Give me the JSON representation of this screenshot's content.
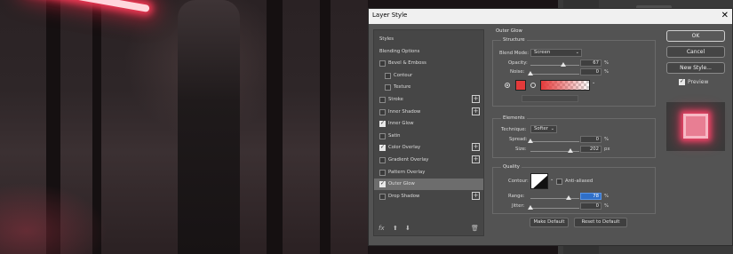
{
  "dialog": {
    "title": "Layer Style",
    "close_glyph": "✕"
  },
  "styles_list": [
    {
      "label": "Styles",
      "checkbox": false,
      "checked": false,
      "plus": false,
      "indent": false,
      "selected": false
    },
    {
      "label": "Blending Options",
      "checkbox": false,
      "checked": false,
      "plus": false,
      "indent": false,
      "selected": false
    },
    {
      "label": "Bevel & Emboss",
      "checkbox": true,
      "checked": false,
      "plus": false,
      "indent": false,
      "selected": false
    },
    {
      "label": "Contour",
      "checkbox": true,
      "checked": false,
      "plus": false,
      "indent": true,
      "selected": false
    },
    {
      "label": "Texture",
      "checkbox": true,
      "checked": false,
      "plus": false,
      "indent": true,
      "selected": false
    },
    {
      "label": "Stroke",
      "checkbox": true,
      "checked": false,
      "plus": true,
      "indent": false,
      "selected": false
    },
    {
      "label": "Inner Shadow",
      "checkbox": true,
      "checked": false,
      "plus": true,
      "indent": false,
      "selected": false
    },
    {
      "label": "Inner Glow",
      "checkbox": true,
      "checked": true,
      "plus": false,
      "indent": false,
      "selected": false
    },
    {
      "label": "Satin",
      "checkbox": true,
      "checked": false,
      "plus": false,
      "indent": false,
      "selected": false
    },
    {
      "label": "Color Overlay",
      "checkbox": true,
      "checked": true,
      "plus": true,
      "indent": false,
      "selected": false
    },
    {
      "label": "Gradient Overlay",
      "checkbox": true,
      "checked": false,
      "plus": true,
      "indent": false,
      "selected": false
    },
    {
      "label": "Pattern Overlay",
      "checkbox": true,
      "checked": false,
      "plus": false,
      "indent": false,
      "selected": false
    },
    {
      "label": "Outer Glow",
      "checkbox": true,
      "checked": true,
      "plus": false,
      "indent": false,
      "selected": true
    },
    {
      "label": "Drop Shadow",
      "checkbox": true,
      "checked": false,
      "plus": true,
      "indent": false,
      "selected": false
    }
  ],
  "list_footer": {
    "fx": "fx",
    "up": "⬆",
    "down": "⬇",
    "trash": "🗑"
  },
  "outer_glow": {
    "section_title": "Outer Glow",
    "structure": {
      "title": "Structure",
      "blend_mode_label": "Blend Mode:",
      "blend_mode_value": "Screen",
      "opacity_label": "Opacity:",
      "opacity_value": "67",
      "opacity_fraction": 0.67,
      "noise_label": "Noise:",
      "noise_value": "0",
      "noise_fraction": 0,
      "percent": "%",
      "glow_color": "#e43a3a"
    },
    "elements": {
      "title": "Elements",
      "technique_label": "Technique:",
      "technique_value": "Softer",
      "spread_label": "Spread:",
      "spread_value": "0",
      "spread_fraction": 0,
      "size_label": "Size:",
      "size_value": "202",
      "size_fraction": 0.81,
      "percent": "%",
      "px": "px"
    },
    "quality": {
      "title": "Quality",
      "contour_label": "Contour:",
      "anti_aliased_label": "Anti-aliased",
      "range_label": "Range:",
      "range_value": "78",
      "range_fraction": 0.78,
      "jitter_label": "Jitter:",
      "jitter_value": "0",
      "jitter_fraction": 0,
      "percent": "%"
    },
    "make_default": "Make Default",
    "reset_to_default": "Reset to Default"
  },
  "buttons": {
    "ok": "OK",
    "cancel": "Cancel",
    "new_style": "New Style...",
    "preview_label": "Preview",
    "preview_checked": true
  },
  "colors": {
    "accent_highlight": "#2f6fc8",
    "glow": "#e43a3a"
  }
}
